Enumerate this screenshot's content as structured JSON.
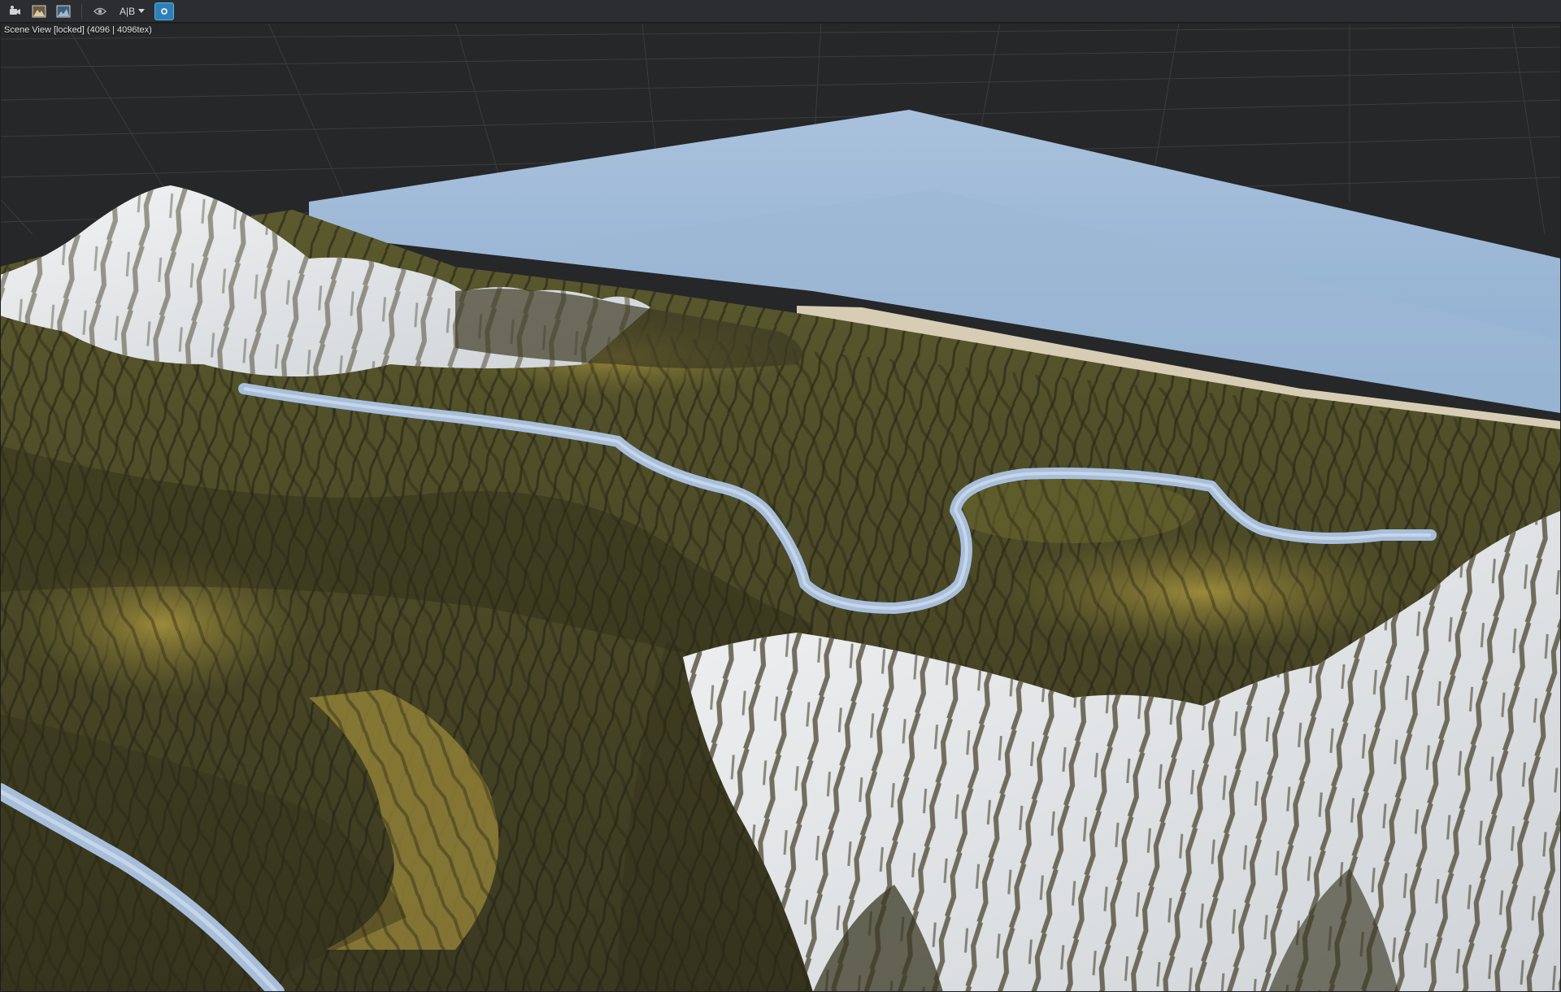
{
  "toolbar": {
    "buttons": [
      {
        "name": "camera-settings-icon"
      },
      {
        "name": "scene-render-icon"
      },
      {
        "name": "texture-preview-icon"
      },
      {
        "name": "visibility-eye-icon"
      }
    ],
    "ab_label": "A|B",
    "active_button": "live-update-icon"
  },
  "viewport": {
    "label": "Scene View [locked] (4096 | 4096tex)"
  },
  "colors": {
    "background": "#262729",
    "grid_line": "#3a3c3f",
    "water": "#9ab6d4",
    "snow": "#e8eaec",
    "grass": "#7f7334",
    "rock": "#3a3a24",
    "river": "#a7bedb",
    "accent": "#2f7fb6"
  }
}
